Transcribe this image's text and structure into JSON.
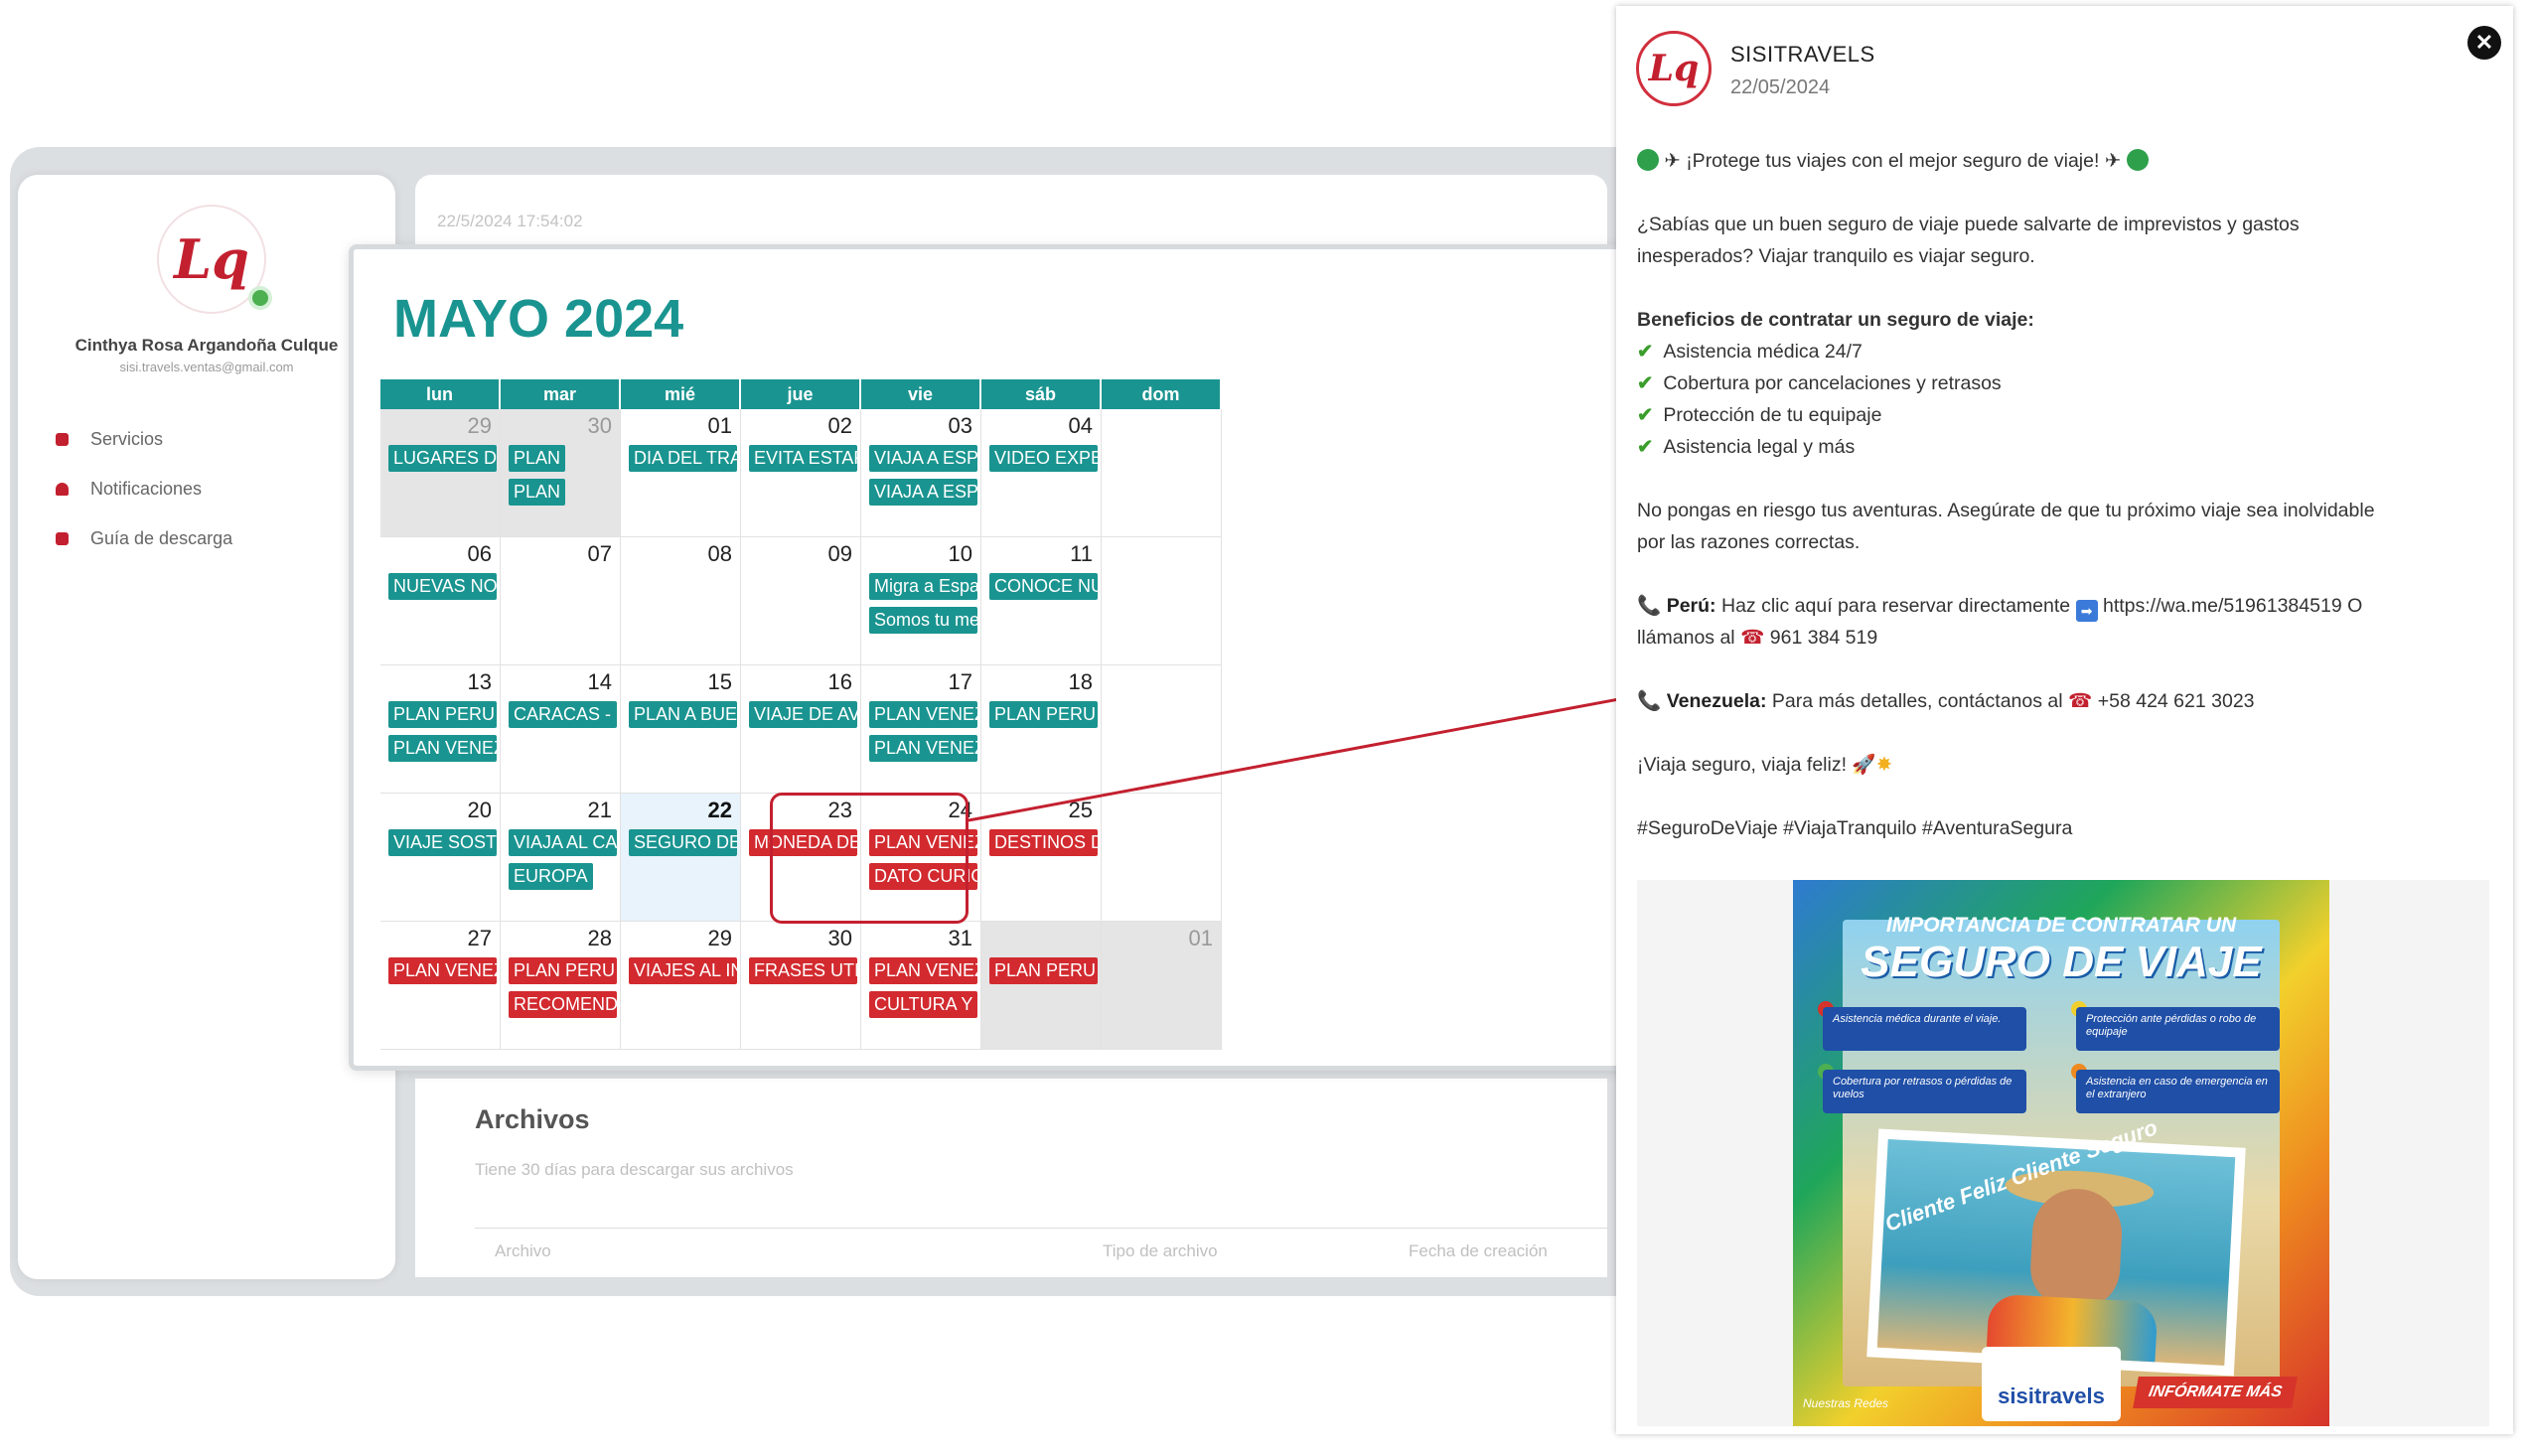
{
  "dashboard": {
    "user_name": "Cinthya Rosa Argandoña Culque",
    "user_email": "sisi.travels.ventas@gmail.com",
    "menu": [
      {
        "label": "Servicios",
        "icon": "briefcase-icon"
      },
      {
        "label": "Notificaciones",
        "icon": "bell-icon"
      },
      {
        "label": "Guía de descarga",
        "icon": "download-icon"
      }
    ],
    "timestamp": "22/5/2024 17:54:02",
    "files": {
      "title": "Archivos",
      "subtitle": "Tiene 30 días para descargar sus archivos",
      "columns": [
        "Archivo",
        "Tipo de archivo",
        "Fecha de creación"
      ]
    }
  },
  "calendar": {
    "title": "MAYO 2024",
    "weekdays": [
      "lun",
      "mar",
      "mié",
      "jue",
      "vie",
      "sáb",
      "dom"
    ],
    "weeks": [
      [
        {
          "day": "29",
          "gray": true,
          "events": [
            {
              "t": "LUGARES DESCONOCIDOS",
              "c": "teal"
            }
          ]
        },
        {
          "day": "30",
          "gray": true,
          "events": [
            {
              "t": "PLAN",
              "c": "teal"
            },
            {
              "t": "PLAN",
              "c": "teal"
            }
          ]
        },
        {
          "day": "01",
          "events": [
            {
              "t": "DIA DEL TRABAJADOR",
              "c": "teal"
            }
          ]
        },
        {
          "day": "02",
          "events": [
            {
              "t": "EVITA ESTAFAS",
              "c": "teal"
            }
          ]
        },
        {
          "day": "03",
          "events": [
            {
              "t": "VIAJA A ESPAÑA",
              "c": "teal"
            },
            {
              "t": "VIAJA A ESPAÑA",
              "c": "teal"
            }
          ]
        },
        {
          "day": "04",
          "events": [
            {
              "t": "VIDEO EXPERIENCIA",
              "c": "teal"
            }
          ]
        },
        {
          "day": "",
          "events": []
        }
      ],
      [
        {
          "day": "06",
          "events": [
            {
              "t": "NUEVAS NOTICIAS",
              "c": "teal"
            }
          ]
        },
        {
          "day": "07",
          "events": []
        },
        {
          "day": "08",
          "events": []
        },
        {
          "day": "09",
          "events": []
        },
        {
          "day": "10",
          "events": [
            {
              "t": "Migra a España",
              "c": "teal"
            },
            {
              "t": "Somos tu mejor opción",
              "c": "teal"
            }
          ]
        },
        {
          "day": "11",
          "events": [
            {
              "t": "CONOCE NUESTROS",
              "c": "teal"
            }
          ]
        },
        {
          "day": "",
          "events": []
        }
      ],
      [
        {
          "day": "13",
          "events": [
            {
              "t": "PLAN PERU A VENEZUELA",
              "c": "teal"
            },
            {
              "t": "PLAN VENEZUELA A",
              "c": "teal"
            }
          ]
        },
        {
          "day": "14",
          "events": [
            {
              "t": "CARACAS - MADRID",
              "c": "teal"
            }
          ]
        },
        {
          "day": "15",
          "events": [
            {
              "t": "PLAN A BUENOS AIRES",
              "c": "teal"
            }
          ]
        },
        {
          "day": "16",
          "events": [
            {
              "t": "VIAJE DE AVENTURA",
              "c": "teal"
            }
          ]
        },
        {
          "day": "17",
          "events": [
            {
              "t": "PLAN VENEZUELA",
              "c": "teal"
            },
            {
              "t": "PLAN VENEZUELA",
              "c": "teal"
            }
          ]
        },
        {
          "day": "18",
          "events": [
            {
              "t": "PLAN PERU",
              "c": "teal"
            }
          ]
        },
        {
          "day": "",
          "events": []
        }
      ],
      [
        {
          "day": "20",
          "events": [
            {
              "t": "VIAJE SOSTENIBLE",
              "c": "teal"
            }
          ]
        },
        {
          "day": "21",
          "events": [
            {
              "t": "VIAJA AL CARIBE",
              "c": "teal"
            },
            {
              "t": "EUROPA",
              "c": "teal"
            }
          ]
        },
        {
          "day": "22",
          "selected": true,
          "events": [
            {
              "t": "SEGURO DE VIAJES",
              "c": "teal"
            }
          ]
        },
        {
          "day": "23",
          "events": [
            {
              "t": "MONEDA DE CAMBIO",
              "c": "red"
            }
          ]
        },
        {
          "day": "24",
          "events": [
            {
              "t": "PLAN VENEZUELA",
              "c": "red"
            },
            {
              "t": "DATO CURIOSO",
              "c": "red"
            }
          ]
        },
        {
          "day": "25",
          "events": [
            {
              "t": "DESTINOS DE SNOW",
              "c": "red"
            }
          ]
        },
        {
          "day": "",
          "events": []
        }
      ],
      [
        {
          "day": "27",
          "events": [
            {
              "t": "PLAN VENEZUELA",
              "c": "red"
            }
          ]
        },
        {
          "day": "28",
          "events": [
            {
              "t": "PLAN PERU",
              "c": "red"
            },
            {
              "t": "RECOMENDACION DE",
              "c": "red"
            }
          ]
        },
        {
          "day": "29",
          "events": [
            {
              "t": "VIAJES AL INTERIOR",
              "c": "red"
            }
          ]
        },
        {
          "day": "30",
          "events": [
            {
              "t": "FRASES UTILES PARA",
              "c": "red"
            }
          ]
        },
        {
          "day": "31",
          "events": [
            {
              "t": "PLAN VENEZUELA",
              "c": "red"
            },
            {
              "t": "CULTURA Y COSTUMBRES",
              "c": "red"
            }
          ]
        },
        {
          "day": "",
          "gray": true,
          "events": [
            {
              "t": "PLAN PERU",
              "c": "red"
            }
          ]
        },
        {
          "day": "01",
          "gray": true,
          "events": []
        }
      ]
    ]
  },
  "post": {
    "account": "SISITRAVELS",
    "date": "22/05/2024",
    "headline": "¡Protege tus viajes con el mejor seguro de viaje!",
    "intro_1": "¿Sabías que un buen seguro de viaje puede salvarte de imprevistos y gastos",
    "intro_2": "inesperados? Viajar tranquilo es viajar seguro.",
    "benefits_title": "Beneficios de contratar un seguro de viaje:",
    "benefits": [
      "Asistencia médica 24/7",
      "Cobertura por cancelaciones y retrasos",
      "Protección de tu equipaje",
      "Asistencia legal y más"
    ],
    "risk_1": "No pongas en riesgo tus aventuras. Asegúrate de que tu próximo viaje sea inolvidable",
    "risk_2": "por las razones correctas.",
    "peru_label": "Perú:",
    "peru_text": " Haz clic aquí para reservar directamente",
    "peru_link": "https://wa.me/51961384519",
    "peru_or": "O",
    "peru_call": "llámanos al",
    "peru_phone": "961 384 519",
    "ven_label": "Venezuela:",
    "ven_text": " Para más detalles, contáctanos al",
    "ven_phone": "+58 424 621 3023",
    "closing": "¡Viaja seguro, viaja feliz!",
    "hashtags": "#SeguroDeViaje #ViajaTranquilo #AventuraSegura",
    "image": {
      "line1": "IMPORTANCIA DE CONTRATAR UN",
      "line2": "SEGURO DE VIAJE",
      "boxes": [
        "Asistencia médica durante el viaje.",
        "Protección ante pérdidas o robo de equipaje",
        "Cobertura por retrasos o pérdidas de vuelos",
        "Asistencia en caso de emergencia en el extranjero"
      ],
      "caption": "Cliente Feliz Cliente Seguro",
      "brand": "sisitravels",
      "social": "Nuestras Redes",
      "cta": "INFÓRMATE MÁS"
    }
  },
  "colors": {
    "teal": "#1a9490",
    "red": "#d22a2f",
    "brand": "#c3202f"
  }
}
